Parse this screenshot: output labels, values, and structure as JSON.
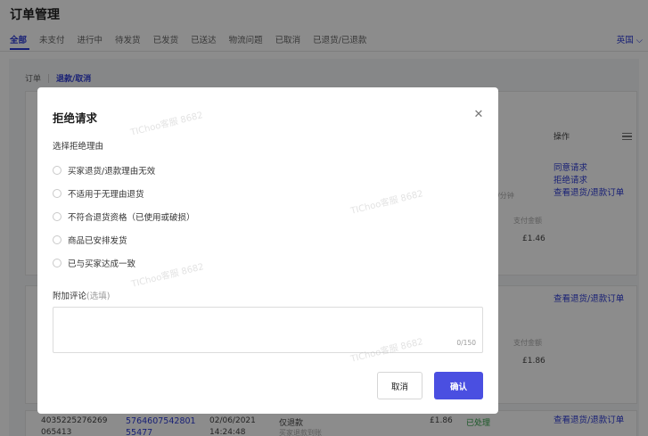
{
  "page": {
    "title": "订单管理",
    "status_tabs": [
      "全部",
      "未支付",
      "进行中",
      "待发货",
      "已发货",
      "已送达",
      "物流问题",
      "已取消",
      "已退货/已退款"
    ],
    "country": "英国"
  },
  "sub_tabs": [
    "订单",
    "退款/取消"
  ],
  "background": {
    "operation_header": "操作",
    "card_a": {
      "actions": [
        "同意请求",
        "拒绝请求",
        "查看退货/退款订单"
      ],
      "partial_label": "/分钟",
      "pay_label": "支付金额",
      "pay_amount": "£1.46"
    },
    "card_b": {
      "action": "查看退货/退款订单",
      "pay_label": "支付金额",
      "pay_amount": "£1.86"
    },
    "card_c": {
      "order_id": "4035225276269",
      "order_id_2": "065413",
      "product_id": "5764607542801",
      "product_id_2": "55477",
      "date": "02/06/2021",
      "time": "14:24:48",
      "type": "仅退款",
      "type_sub": "买家退款到账",
      "amount": "£1.86",
      "status": "已处理",
      "action": "查看退货/退款订单"
    }
  },
  "modal": {
    "title": "拒绝请求",
    "section_label": "选择拒绝理由",
    "reasons": [
      "买家退货/退款理由无效",
      "不适用于无理由退货",
      "不符合退货资格（已使用或破损）",
      "商品已安排发货",
      "已与买家达成一致"
    ],
    "comment_label": "附加评论",
    "comment_optional": "(选填)",
    "comment_value": "",
    "char_count": "0/150",
    "cancel_label": "取消",
    "confirm_label": "确认"
  },
  "watermark": "TIChoo客服 8682",
  "colors": {
    "accent": "#2d3bd6",
    "confirm_button": "#4a4fe1",
    "success": "#2e9e46",
    "overlay": "rgba(0,0,0,0.45)"
  }
}
